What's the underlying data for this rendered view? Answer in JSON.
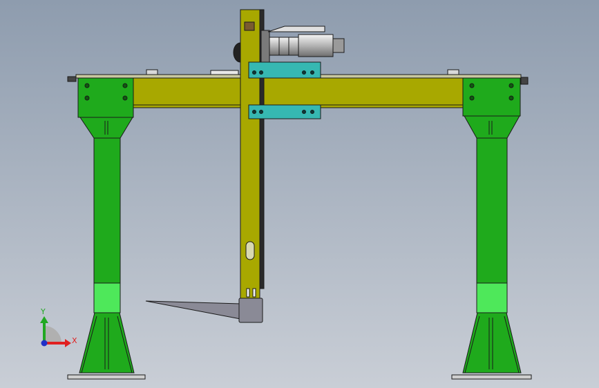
{
  "viewport": {
    "background_top": "#8e9cae",
    "background_bottom": "#c9ced6"
  },
  "colors": {
    "frame_green": "#1faa1c",
    "frame_green_light": "#4ee85a",
    "beam_yellow": "#a8a800",
    "carriage_cyan": "#36b8b2",
    "motor_gray": "#b8b8b8",
    "fork_gray": "#8a8a96",
    "outline": "#1a1a1a"
  },
  "triad": {
    "y_label": "Y",
    "x_label": "X",
    "y_color": "#21a821",
    "x_color": "#e02020",
    "z_color": "#2030c8"
  }
}
